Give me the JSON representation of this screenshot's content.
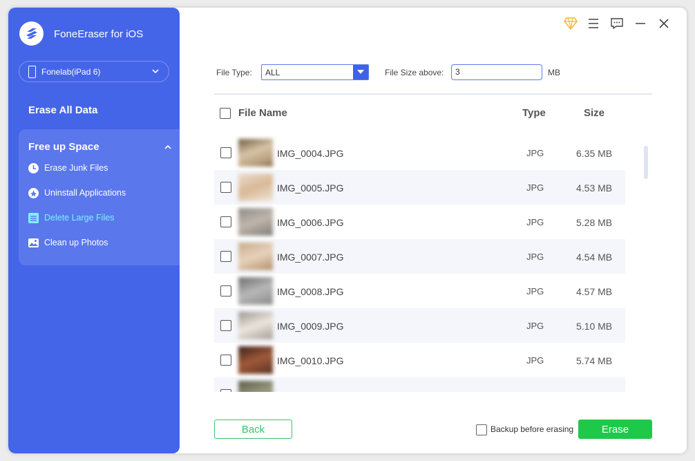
{
  "app": {
    "title": "FoneEraser for iOS",
    "device_label": "Fonelab(iPad 6)"
  },
  "sidebar": {
    "erase_all": "Erase All Data",
    "free_up": {
      "title": "Free up Space",
      "items": [
        {
          "label": "Erase Junk Files",
          "icon": "clock-icon"
        },
        {
          "label": "Uninstall Applications",
          "icon": "app-store-icon"
        },
        {
          "label": "Delete Large Files",
          "icon": "file-list-icon",
          "active": true
        },
        {
          "label": "Clean up Photos",
          "icon": "photo-icon"
        }
      ]
    }
  },
  "filters": {
    "file_type_label": "File Type:",
    "file_type_value": "ALL",
    "file_size_label": "File Size above:",
    "file_size_value": "3",
    "file_size_unit": "MB"
  },
  "table": {
    "headers": {
      "name": "File Name",
      "type": "Type",
      "size": "Size"
    },
    "rows": [
      {
        "name": "IMG_0004.JPG",
        "type": "JPG",
        "size": "6.35 MB"
      },
      {
        "name": "IMG_0005.JPG",
        "type": "JPG",
        "size": "4.53 MB"
      },
      {
        "name": "IMG_0006.JPG",
        "type": "JPG",
        "size": "5.28 MB"
      },
      {
        "name": "IMG_0007.JPG",
        "type": "JPG",
        "size": "4.54 MB"
      },
      {
        "name": "IMG_0008.JPG",
        "type": "JPG",
        "size": "4.57 MB"
      },
      {
        "name": "IMG_0009.JPG",
        "type": "JPG",
        "size": "5.10 MB"
      },
      {
        "name": "IMG_0010.JPG",
        "type": "JPG",
        "size": "5.74 MB"
      }
    ]
  },
  "footer": {
    "back_label": "Back",
    "backup_label": "Backup before erasing",
    "erase_label": "Erase"
  },
  "colors": {
    "sidebar": "#4565e8",
    "accent": "#3f63e6",
    "erase_button": "#1ec94a",
    "active_menu": "#7ff0ff"
  }
}
